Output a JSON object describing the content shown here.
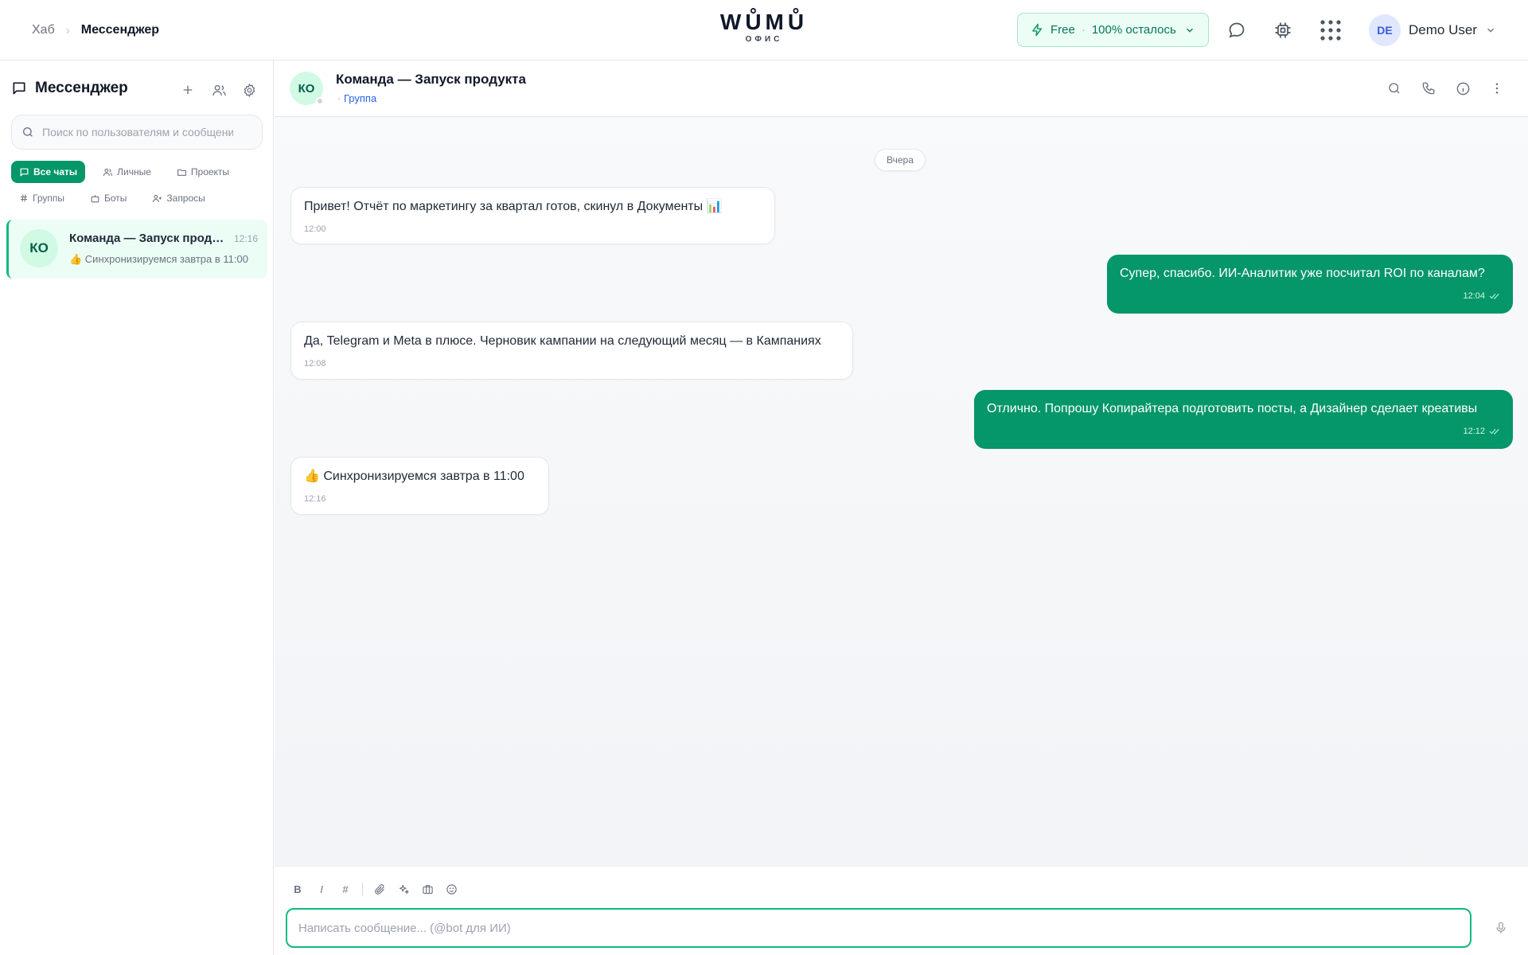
{
  "header": {
    "breadcrumb": {
      "hub": "Хаб",
      "separator": "›",
      "current": "Мессенджер"
    },
    "logo": {
      "main": "WŮMŮ",
      "sub": "ОФИС"
    },
    "plan": {
      "name": "Free",
      "dot": "·",
      "remaining": "100% осталось"
    },
    "icons": [
      "chat-bubble-icon",
      "chip-icon",
      "apps-grid-icon"
    ],
    "user": {
      "initials": "DE",
      "name": "Demo User"
    }
  },
  "sidebar": {
    "title": "Мессенджер",
    "search_placeholder": "Поиск по пользователям и сообщениям",
    "filters_row1": [
      {
        "label": "Все чаты",
        "icon": "chat-icon",
        "active": true
      },
      {
        "label": "Личные",
        "icon": "users-icon",
        "active": false
      },
      {
        "label": "Проекты",
        "icon": "folder-icon",
        "active": false
      }
    ],
    "filters_row2": [
      {
        "label": "Группы",
        "icon": "hash-icon",
        "active": false
      },
      {
        "label": "Боты",
        "icon": "bot-icon",
        "active": false
      },
      {
        "label": "Запросы",
        "icon": "user-plus-icon",
        "active": false
      }
    ],
    "chats": [
      {
        "initials": "КО",
        "name": "Команда — Запуск продукта",
        "time": "12:16",
        "preview": "👍 Синхронизируемся завтра в 11:00"
      }
    ]
  },
  "chat": {
    "initials": "КО",
    "title": "Команда — Запуск продукта",
    "sub_prefix": "·",
    "sub_type": "Группа",
    "date_divider": "Вчера",
    "messages": [
      {
        "direction": "in",
        "text": "Привет! Отчёт по маркетингу за квартал готов, скинул в Документы 📊",
        "time": "12:00"
      },
      {
        "direction": "out",
        "text": "Супер, спасибо. ИИ-Аналитик уже посчитал ROI по каналам?",
        "time": "12:04"
      },
      {
        "direction": "in",
        "text": "Да, Telegram и Meta в плюсе. Черновик кампании на следующий месяц — в Кампаниях",
        "time": "12:08"
      },
      {
        "direction": "out",
        "text": "Отлично. Попрошу Копирайтера подготовить посты, а Дизайнер сделает креативы",
        "time": "12:12"
      },
      {
        "direction": "in",
        "text": "👍 Синхронизируемся завтра в 11:00",
        "time": "12:16"
      }
    ]
  },
  "composer": {
    "format_buttons": [
      "B",
      "I",
      "#"
    ],
    "placeholder": "Написать сообщение... (@bot для ИИ)"
  },
  "colors": {
    "accent": "#059669",
    "accent_light": "#ecfdf5",
    "link": "#2563eb",
    "user_avatar_bg": "#e0e7ff"
  }
}
